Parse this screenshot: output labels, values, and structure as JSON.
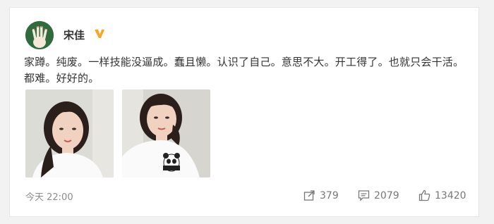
{
  "post": {
    "author": "宋佳",
    "text": "家蹲。纯废。一样技能没逼成。蠢且懒。认识了自己。意思不大。开工得了。也就只会干活。都难。好好的。",
    "timestamp": "今天 22:00",
    "photos": [
      "photo-1",
      "photo-2"
    ]
  },
  "actions": {
    "repost_count": "379",
    "comment_count": "2079",
    "like_count": "13420"
  },
  "icons": {
    "verified": "verified-v-icon",
    "repost": "repost-icon",
    "comment": "comment-icon",
    "like": "thumbs-up-icon"
  },
  "colors": {
    "verified": "#f5a623",
    "avatar_bg": "#2f6b3c",
    "text": "#333333",
    "muted": "#8c8c8c"
  }
}
